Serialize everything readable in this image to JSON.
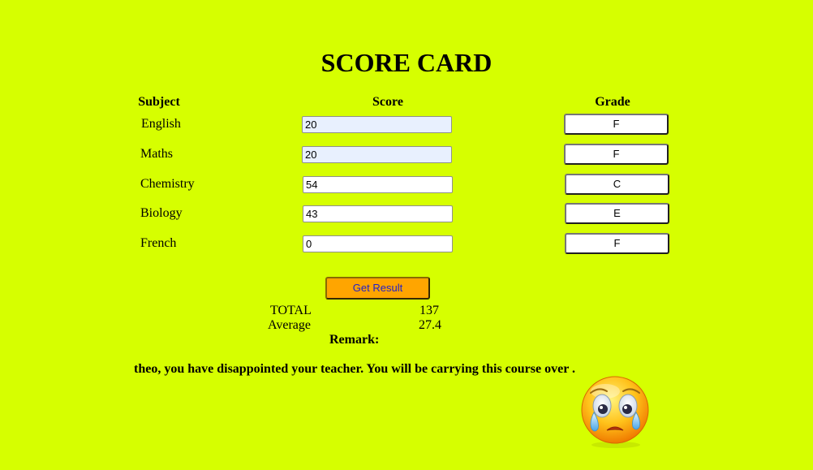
{
  "title": "SCORE CARD",
  "headers": {
    "subject": "Subject",
    "score": "Score",
    "grade": "Grade"
  },
  "rows": [
    {
      "subject": "English",
      "score": "20",
      "grade": "F"
    },
    {
      "subject": "Maths",
      "score": "20",
      "grade": "F"
    },
    {
      "subject": "Chemistry",
      "score": "54",
      "grade": "C"
    },
    {
      "subject": "Biology",
      "score": "43",
      "grade": "E"
    },
    {
      "subject": "French",
      "score": "0",
      "grade": "F"
    }
  ],
  "result_button": "Get Result",
  "stats": {
    "total_label": "TOTAL",
    "total_value": "137",
    "average_label": "Average",
    "average_value": "27.4"
  },
  "remark": {
    "label": "Remark:",
    "text": "theo, you have disappointed your teacher. You will be carrying this course over ."
  },
  "emoji": {
    "icon": "crying-face-icon"
  },
  "colors": {
    "background": "#d6ff00",
    "result_button": "#ffa500",
    "result_button_text": "#1f1fcc"
  }
}
